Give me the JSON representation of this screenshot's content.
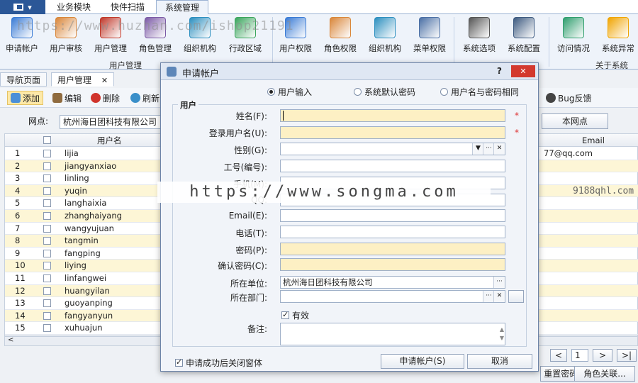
{
  "app": {
    "menu_label": "▾"
  },
  "top_tabs": [
    {
      "label": "业务模块",
      "active": false
    },
    {
      "label": "快件扫描",
      "active": false
    },
    {
      "label": "系统管理",
      "active": true
    }
  ],
  "ribbon": {
    "buttons": [
      {
        "label": "申请帐户",
        "icon": "user-add-icon",
        "color": "#3a7bd5"
      },
      {
        "label": "用户审核",
        "icon": "user-check-icon",
        "color": "#d9863a"
      },
      {
        "label": "用户管理",
        "icon": "users-icon",
        "color": "#c0392b"
      },
      {
        "label": "角色管理",
        "icon": "role-icon",
        "color": "#7b5aa6"
      },
      {
        "label": "组织机构",
        "icon": "org-icon",
        "color": "#2c8fbf"
      },
      {
        "label": "行政区域",
        "icon": "region-icon",
        "color": "#3aa55d"
      },
      {
        "label": "用户权限",
        "icon": "user-permission-icon",
        "color": "#3a7bd5"
      },
      {
        "label": "角色权限",
        "icon": "role-permission-icon",
        "color": "#d9863a"
      },
      {
        "label": "组织机构",
        "icon": "org-permission-icon",
        "color": "#2c8fbf"
      },
      {
        "label": "菜单权限",
        "icon": "menu-permission-icon",
        "color": "#4a6fa5"
      },
      {
        "label": "系统选项",
        "icon": "tools-icon",
        "color": "#555555"
      },
      {
        "label": "系统配置",
        "icon": "monitor-icon",
        "color": "#3d5a80"
      },
      {
        "label": "访问情况",
        "icon": "chart-icon",
        "color": "#2f9e6e"
      },
      {
        "label": "系统异常",
        "icon": "warning-icon",
        "color": "#f0a400"
      }
    ],
    "groups": [
      "用户管理",
      "关于系统"
    ]
  },
  "doc_tabs": [
    {
      "label": "导航页面"
    },
    {
      "label": "用户管理",
      "close": "✕"
    }
  ],
  "toolbar": {
    "add": "添加",
    "edit": "编辑",
    "delete": "删除",
    "refresh": "刷新",
    "bug": "Bug反馈"
  },
  "branch": {
    "label": "网点:",
    "value": "杭州海日团科技有限公司",
    "this_branch": "本网点"
  },
  "grid": {
    "col_username": "用户名",
    "col_email": "Email",
    "first_email": "77@qq.com",
    "rows": [
      {
        "n": "1",
        "name": "lijia"
      },
      {
        "n": "2",
        "name": "jiangyanxiao"
      },
      {
        "n": "3",
        "name": "linling"
      },
      {
        "n": "4",
        "name": "yuqin"
      },
      {
        "n": "5",
        "name": "langhaixia"
      },
      {
        "n": "6",
        "name": "zhanghaiyang"
      },
      {
        "n": "7",
        "name": "wangyujuan"
      },
      {
        "n": "8",
        "name": "tangmin"
      },
      {
        "n": "9",
        "name": "fangping"
      },
      {
        "n": "10",
        "name": "liying"
      },
      {
        "n": "11",
        "name": "linfangwei"
      },
      {
        "n": "12",
        "name": "huangyilan"
      },
      {
        "n": "13",
        "name": "guoyanping"
      },
      {
        "n": "14",
        "name": "fangyanyun"
      },
      {
        "n": "15",
        "name": "xuhuajun"
      }
    ]
  },
  "pager": {
    "prev": "<",
    "page": "1",
    "next": ">",
    "last": ">|"
  },
  "bottom_buttons": {
    "b1": "重置密码...",
    "b2": "角色关联..."
  },
  "dialog": {
    "title": "申请帐户",
    "help": "?",
    "close": "✕",
    "radios": [
      "用户输入",
      "系统默认密码",
      "用户名与密码相同"
    ],
    "section": "用户",
    "fields": {
      "name": "姓名(F):",
      "login": "登录用户名(U):",
      "gender": "性别(G):",
      "code": "工号(编号):",
      "mobile": "手机(M):",
      "qq": "QQ:",
      "email": "Email(E):",
      "phone": "电话(T):",
      "password": "密码(P):",
      "confirm": "确认密码(C):",
      "company": "所在单位:",
      "company_value": "杭州海日团科技有限公司",
      "dept": "所在部门:",
      "enabled": "有效",
      "remark": "备注:"
    },
    "close_after": "申请成功后关闭窗体",
    "submit": "申请帐户(S)",
    "cancel": "取消"
  },
  "watermarks": {
    "top": "https://www.huzhan.com/ishop21191",
    "center": "https://www.songma.com",
    "right": "9188qhl.com"
  }
}
